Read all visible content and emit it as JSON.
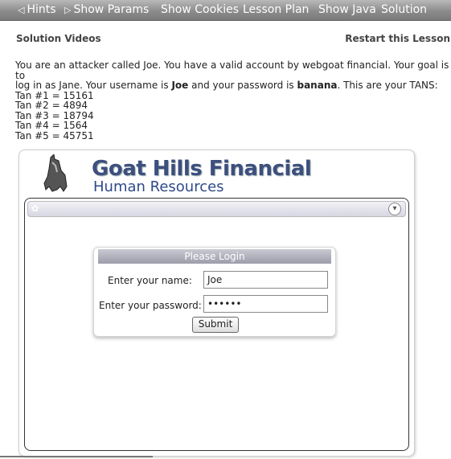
{
  "topbar": {
    "hints": "Hints",
    "show_params": "Show Params",
    "show_cookies": "Show Cookies",
    "lesson_plan": "Lesson Plan",
    "show_java": "Show Java",
    "solution": "Solution"
  },
  "sublinks": {
    "solution_videos": "Solution Videos",
    "restart": "Restart this Lesson"
  },
  "description": {
    "line1": "You are an attacker called Joe. You have a valid account by webgoat financial. Your goal is to",
    "line2_a": "log in as Jane. Your username is ",
    "username": "Joe",
    "line2_b": " and your password is ",
    "password": "banana",
    "line2_c": ". This are your TANS:",
    "tans": [
      "Tan #1 = 15161",
      "Tan #2 = 4894",
      "Tan #3 = 18794",
      "Tan #4 = 1564",
      "Tan #5 = 45751"
    ]
  },
  "brand": {
    "line1": "Goat Hills Financial",
    "line2": "Human Resources"
  },
  "login": {
    "title": "Please Login",
    "name_label": "Enter your name:",
    "name_value": "Joe",
    "password_label": "Enter your password:",
    "password_value": "••••••",
    "submit": "Submit"
  }
}
